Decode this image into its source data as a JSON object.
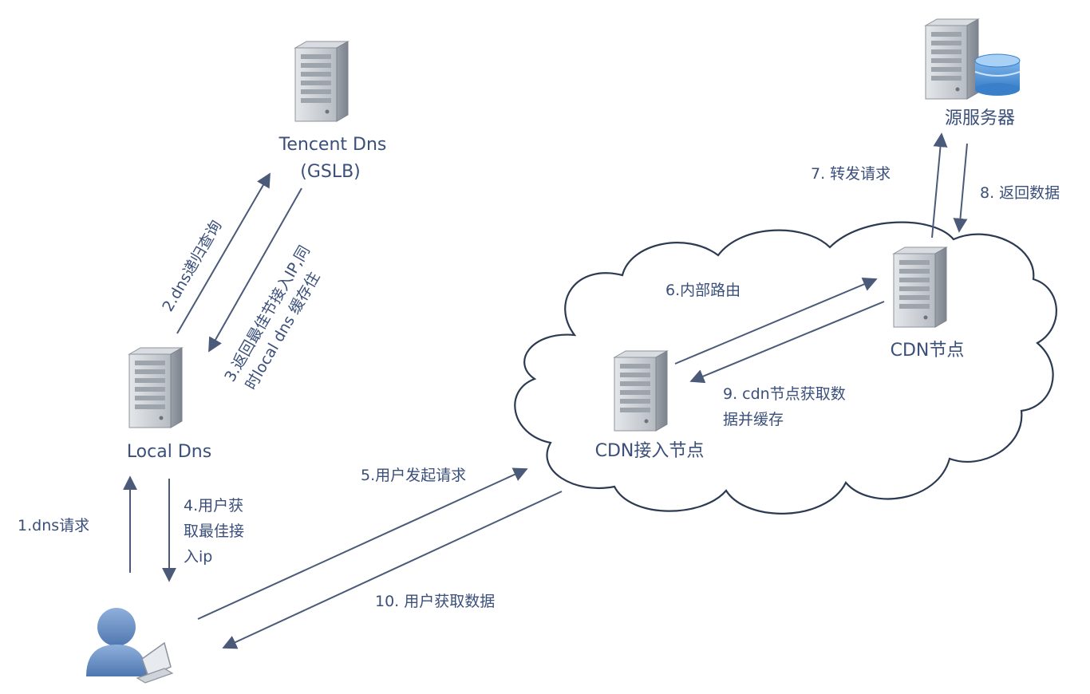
{
  "nodes": {
    "tencent_dns": {
      "line1": "Tencent Dns",
      "line2": "(GSLB)"
    },
    "source_server": {
      "label": "源服务器"
    },
    "local_dns": {
      "label": "Local Dns"
    },
    "cdn_node": {
      "label": "CDN节点"
    },
    "cdn_access_node": {
      "label": "CDN接入节点"
    }
  },
  "steps": {
    "s1": "1.dns请求",
    "s2": "2.dns递归查询",
    "s3_line1": "3.返回最佳节接入IP,同",
    "s3_line2": "时local dns 缓存住",
    "s4_line1": "4.用户获",
    "s4_line2": "取最佳接",
    "s4_line3": "入ip",
    "s5": "5.用户发起请求",
    "s6": "6.内部路由",
    "s7": "7. 转发请求",
    "s8": "8. 返回数据",
    "s9_line1": "9. cdn节点获取数",
    "s9_line2": "据并缓存",
    "s10": "10. 用户获取数据"
  },
  "colors": {
    "text": "#3a4f7a",
    "arrow": "#4a5a78",
    "server_body": "#c9cdd3",
    "cloud_stroke": "#2c3a52",
    "user": "#6b8fc2",
    "database": "#4a8fd6"
  },
  "icons": [
    "server-icon",
    "database-icon",
    "user-icon",
    "laptop-icon",
    "cloud-shape"
  ]
}
